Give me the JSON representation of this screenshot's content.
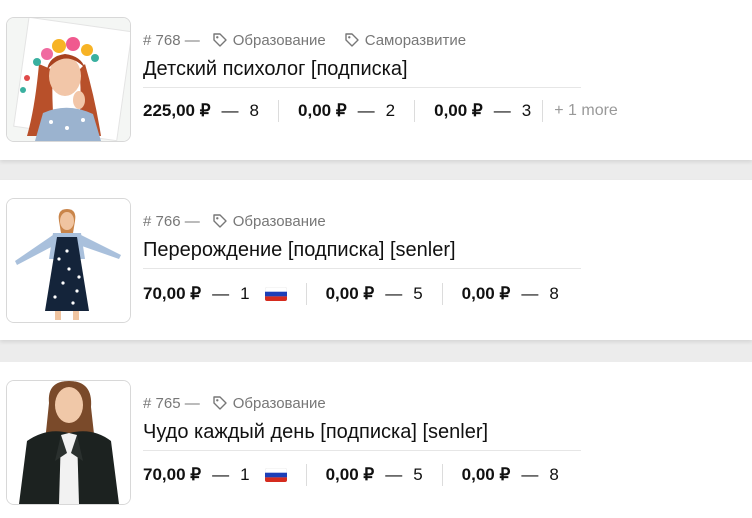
{
  "items": [
    {
      "number": "# 768 —",
      "tags": [
        "Образование",
        "Саморазвитие"
      ],
      "title": "Детский психолог [подписка]",
      "prices": [
        {
          "amount": "225,00 ₽",
          "count": "8"
        },
        {
          "amount": "0,00 ₽",
          "count": "2"
        },
        {
          "amount": "0,00 ₽",
          "count": "3"
        }
      ],
      "more": "+ 1 more"
    },
    {
      "number": "# 766 —",
      "tags": [
        "Образование"
      ],
      "title": "Перерождение [подписка] [senler]",
      "prices": [
        {
          "amount": "70,00 ₽",
          "count": "1",
          "flag": "russia-flag-icon"
        },
        {
          "amount": "0,00 ₽",
          "count": "5"
        },
        {
          "amount": "0,00 ₽",
          "count": "8"
        }
      ]
    },
    {
      "number": "# 765 —",
      "tags": [
        "Образование"
      ],
      "title": "Чудо каждый день [подписка] [senler]",
      "prices": [
        {
          "amount": "70,00 ₽",
          "count": "1",
          "flag": "russia-flag-icon"
        },
        {
          "amount": "0,00 ₽",
          "count": "5"
        },
        {
          "amount": "0,00 ₽",
          "count": "8"
        }
      ]
    }
  ],
  "dash": "—",
  "colors": {
    "flag_white": "#ffffff",
    "flag_blue": "#1c3fb8",
    "flag_red": "#d52b1e"
  }
}
